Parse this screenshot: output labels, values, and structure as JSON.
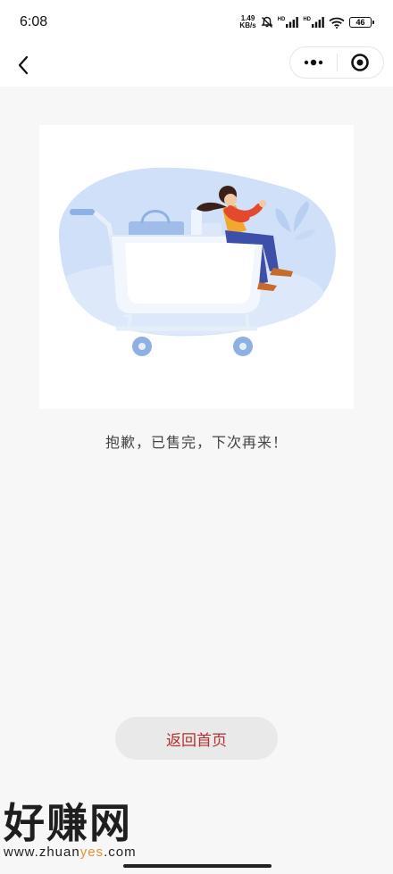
{
  "status_bar": {
    "time": "6:08",
    "net_speed_value": "1.49",
    "net_speed_unit": "KB/s",
    "signal_label_1": "HD",
    "signal_label_2": "HD",
    "battery": "46"
  },
  "nav": {
    "back_icon": "chevron-left-icon",
    "more_icon": "more-dots-icon",
    "close_icon": "target-close-icon"
  },
  "main": {
    "illustration": "shopping-cart-woman-illustration",
    "message": "抱歉，已售完，下次再来！",
    "home_button_label": "返回首页"
  },
  "watermark": {
    "brand": "好赚网",
    "url_prefix": "www.zhuan",
    "url_accent": "yes",
    "url_suffix": ".com"
  },
  "colors": {
    "accent": "#b32f30",
    "background": "#f7f7f7",
    "button_bg": "#e9e9e9"
  }
}
